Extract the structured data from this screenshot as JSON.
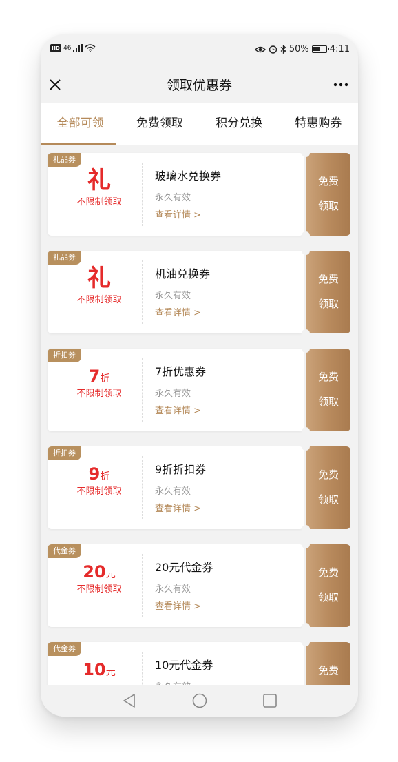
{
  "status_bar": {
    "network": "46",
    "battery_pct": "50%",
    "time": "4:11"
  },
  "nav": {
    "title": "领取优惠券"
  },
  "tabs": [
    {
      "label": "全部可领",
      "active": true
    },
    {
      "label": "免费领取",
      "active": false
    },
    {
      "label": "积分兑换",
      "active": false
    },
    {
      "label": "特惠购券",
      "active": false
    }
  ],
  "coupons": [
    {
      "badge": "礼品券",
      "amount": "礼",
      "unit": "",
      "limit": "不限制领取",
      "name": "玻璃水兑换券",
      "validity": "永久有效",
      "detail": "查看详情 >",
      "claim_line1": "免费",
      "claim_line2": "领取"
    },
    {
      "badge": "礼品券",
      "amount": "礼",
      "unit": "",
      "limit": "不限制领取",
      "name": "机油兑换券",
      "validity": "永久有效",
      "detail": "查看详情 >",
      "claim_line1": "免费",
      "claim_line2": "领取"
    },
    {
      "badge": "折扣券",
      "amount": "7",
      "unit": "折",
      "limit": "不限制领取",
      "name": "7折优惠券",
      "validity": "永久有效",
      "detail": "查看详情 >",
      "claim_line1": "免费",
      "claim_line2": "领取"
    },
    {
      "badge": "折扣券",
      "amount": "9",
      "unit": "折",
      "limit": "不限制领取",
      "name": "9折折扣券",
      "validity": "永久有效",
      "detail": "查看详情 >",
      "claim_line1": "免费",
      "claim_line2": "领取"
    },
    {
      "badge": "代金券",
      "amount": "20",
      "unit": "元",
      "limit": "不限制领取",
      "name": "20元代金券",
      "validity": "永久有效",
      "detail": "查看详情 >",
      "claim_line1": "免费",
      "claim_line2": "领取"
    },
    {
      "badge": "代金券",
      "amount": "10",
      "unit": "元",
      "limit": "",
      "name": "10元代金券",
      "validity": "永久有效",
      "detail": "",
      "claim_line1": "免费",
      "claim_line2": ""
    }
  ],
  "colors": {
    "accent": "#b58a5a",
    "price": "#e52b2b",
    "claim_gradient_start": "#caa279",
    "claim_gradient_end": "#a97b4f"
  },
  "icons": {
    "close": "close-icon",
    "more": "more-icon",
    "back": "back-triangle-icon",
    "home": "home-circle-icon",
    "recents": "recents-square-icon"
  }
}
